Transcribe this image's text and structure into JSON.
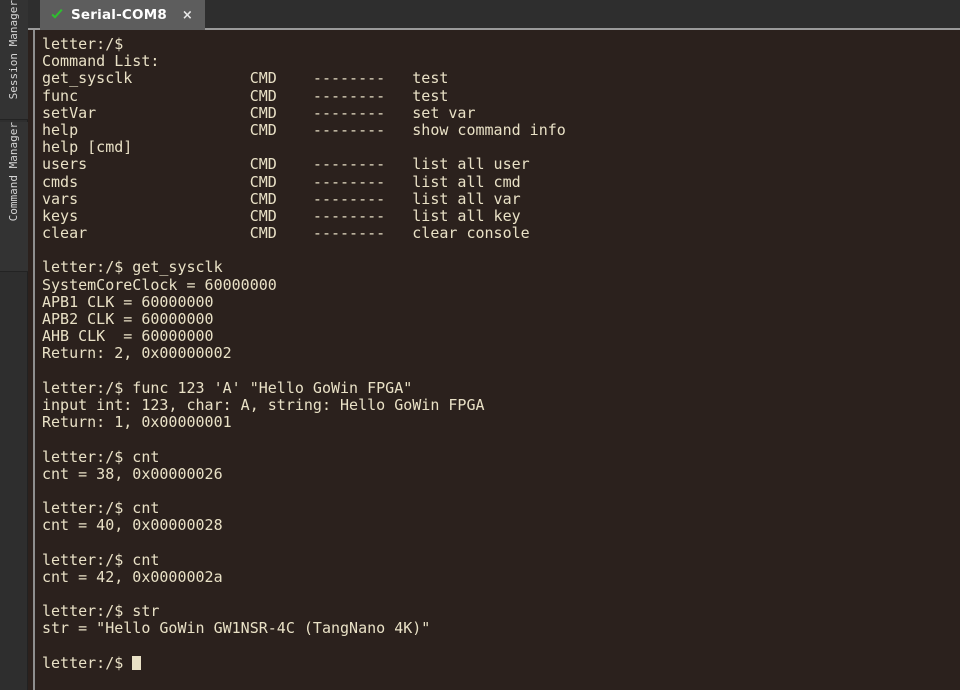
{
  "window": {
    "background_color": "#2b2b2b"
  },
  "sidebar": {
    "items": [
      {
        "id": "session-manager",
        "label": "Session Manager"
      },
      {
        "id": "command-manager",
        "label": "Command Manager"
      }
    ]
  },
  "tabbar": {
    "tabs": [
      {
        "id": "serial-com8",
        "title": "Serial-COM8",
        "status_icon": "check-icon",
        "status_color": "#30c030",
        "close_label": "×",
        "active": true
      }
    ]
  },
  "terminal": {
    "background_color": "#2b211d",
    "foreground_color": "#e9e1c6",
    "prompt": "letter:/$",
    "cursor": {
      "visible": true,
      "style": "block",
      "color": "#e9e1c6"
    },
    "lines": [
      "letter:/$",
      "Command List:",
      "get_sysclk             CMD    --------   test",
      "func                   CMD    --------   test",
      "setVar                 CMD    --------   set var",
      "help                   CMD    --------   show command info",
      "help [cmd]",
      "users                  CMD    --------   list all user",
      "cmds                   CMD    --------   list all cmd",
      "vars                   CMD    --------   list all var",
      "keys                   CMD    --------   list all key",
      "clear                  CMD    --------   clear console",
      "",
      "letter:/$ get_sysclk",
      "SystemCoreClock = 60000000",
      "APB1 CLK = 60000000",
      "APB2 CLK = 60000000",
      "AHB CLK  = 60000000",
      "Return: 2, 0x00000002",
      "",
      "letter:/$ func 123 'A' \"Hello GoWin FPGA\"",
      "input int: 123, char: A, string: Hello GoWin FPGA",
      "Return: 1, 0x00000001",
      "",
      "letter:/$ cnt",
      "cnt = 38, 0x00000026",
      "",
      "letter:/$ cnt",
      "cnt = 40, 0x00000028",
      "",
      "letter:/$ cnt",
      "cnt = 42, 0x0000002a",
      "",
      "letter:/$ str",
      "str = \"Hello GoWin GW1NSR-4C (TangNano 4K)\"",
      "",
      "letter:/$ "
    ],
    "command_table": {
      "columns": [
        "command",
        "type",
        "separator",
        "description"
      ],
      "rows": [
        {
          "command": "get_sysclk",
          "type": "CMD",
          "separator": "--------",
          "description": "test"
        },
        {
          "command": "func",
          "type": "CMD",
          "separator": "--------",
          "description": "test"
        },
        {
          "command": "setVar",
          "type": "CMD",
          "separator": "--------",
          "description": "set var"
        },
        {
          "command": "help",
          "type": "CMD",
          "separator": "--------",
          "description": "show command info"
        },
        {
          "command": "help [cmd]",
          "type": "",
          "separator": "",
          "description": ""
        },
        {
          "command": "users",
          "type": "CMD",
          "separator": "--------",
          "description": "list all user"
        },
        {
          "command": "cmds",
          "type": "CMD",
          "separator": "--------",
          "description": "list all cmd"
        },
        {
          "command": "vars",
          "type": "CMD",
          "separator": "--------",
          "description": "list all var"
        },
        {
          "command": "keys",
          "type": "CMD",
          "separator": "--------",
          "description": "list all key"
        },
        {
          "command": "clear",
          "type": "CMD",
          "separator": "--------",
          "description": "clear console"
        }
      ]
    },
    "readings": {
      "SystemCoreClock": "60000000",
      "APB1_CLK": "60000000",
      "APB2_CLK": "60000000",
      "AHB_CLK": "60000000",
      "cnt_values": [
        "38",
        "40",
        "42"
      ],
      "cnt_hex": [
        "0x00000026",
        "0x00000028",
        "0x0000002a"
      ],
      "str_value": "Hello GoWin GW1NSR-4C (TangNano 4K)"
    }
  }
}
